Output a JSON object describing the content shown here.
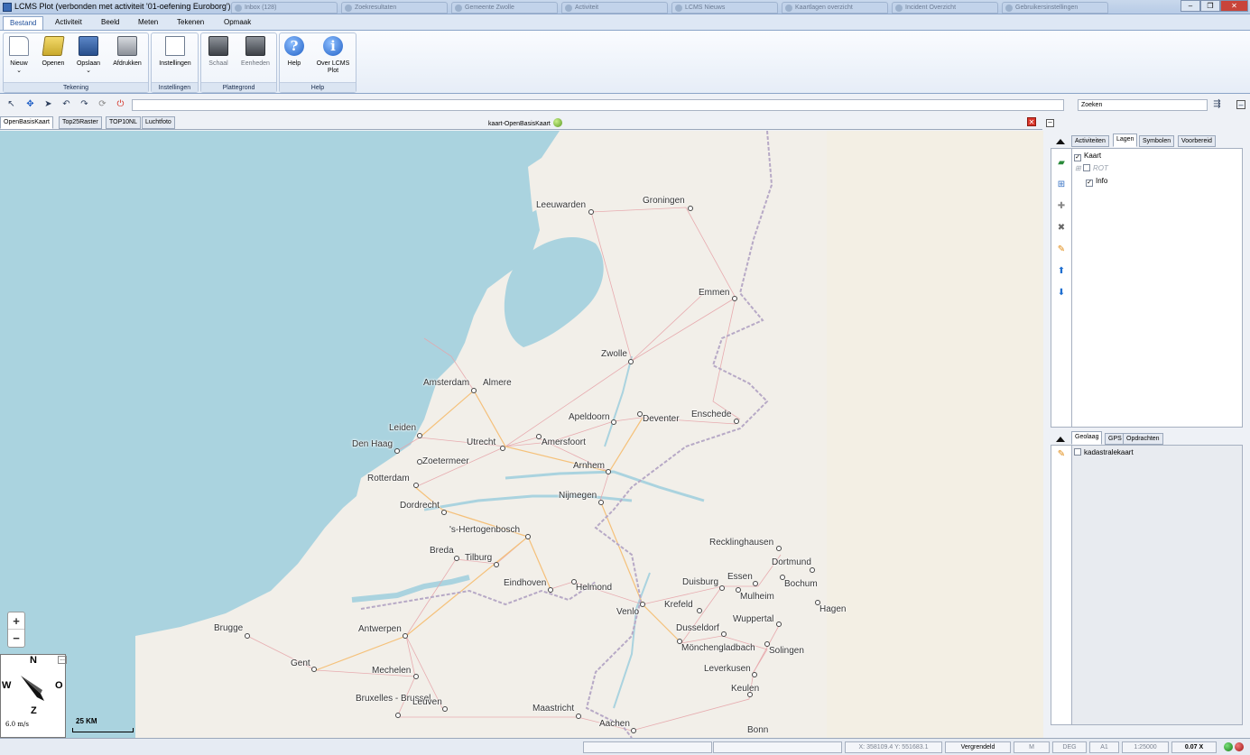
{
  "window": {
    "title": "LCMS Plot (verbonden met activiteit '01-oefening Euroborg')",
    "browser_tabs": [
      "Inbox (128)",
      "Zoekresultaten",
      "Gemeente Zwolle",
      "Activiteit",
      "LCMS Nieuws",
      "Kaartlagen overzicht",
      "Incident Overzicht",
      "Gebruikersinstellingen"
    ]
  },
  "menu": [
    "Bestand",
    "Activiteit",
    "Beeld",
    "Meten",
    "Tekenen",
    "Opmaak"
  ],
  "ribbon": {
    "groups": [
      {
        "name": "Tekening",
        "buttons": [
          "Nieuw",
          "Openen",
          "Opslaan",
          "Afdrukken"
        ]
      },
      {
        "name": "Instellingen",
        "buttons": [
          "Instellingen"
        ]
      },
      {
        "name": "Plattegrond",
        "buttons": [
          "Schaal",
          "Eenheden"
        ]
      },
      {
        "name": "Help",
        "buttons": [
          "Help",
          "Over LCMS Plot"
        ]
      }
    ]
  },
  "search": {
    "placeholder": "Zoeken"
  },
  "map_tabs": [
    "OpenBasisKaart",
    "Top25Raster",
    "TOP10NL",
    "Luchtfoto"
  ],
  "map_title": "kaart-OpenBasisKaart",
  "map": {
    "cities": [
      "Leeuwarden",
      "Groningen",
      "Emmen",
      "Zwolle",
      "Amsterdam",
      "Almere",
      "Apeldoorn",
      "Deventer",
      "Enschede",
      "Leiden",
      "Den Haag",
      "Utrecht",
      "Amersfoort",
      "Zoetermeer",
      "Arnhem",
      "Rotterdam",
      "Nijmegen",
      "Dordrecht",
      "'s-Hertogenbosch",
      "Breda",
      "Tilburg",
      "Recklinghausen",
      "Dortmund",
      "Eindhoven",
      "Helmond",
      "Essen",
      "Bochum",
      "Duisburg",
      "Mulheim",
      "Venlo",
      "Krefeld",
      "Hagen",
      "Brugge",
      "Antwerpen",
      "Wuppertal",
      "Dusseldorf",
      "Mönchengladbach",
      "Solingen",
      "Gent",
      "Mechelen",
      "Leverkusen",
      "Keulen",
      "Bruxelles - Brussel",
      "Leuven",
      "Maastricht",
      "Aachen",
      "Bonn"
    ],
    "zoom_in": "+",
    "zoom_out": "−",
    "compass": {
      "n": "N",
      "w": "W",
      "o": "O",
      "z": "Z",
      "wind": "6.0 m/s",
      "more": "..."
    },
    "scale_label": "25 KM"
  },
  "panel": {
    "top_tabs": [
      "Activiteiten",
      "Lagen",
      "Symbolen",
      "Voorbereid"
    ],
    "layers": {
      "root": "Kaart",
      "child1": "ROT",
      "child2": "Info"
    },
    "bottom_tabs": [
      "Geolaag",
      "GPS",
      "Opdrachten"
    ],
    "geolayers": [
      "kadastralekaart"
    ]
  },
  "status": {
    "coords": "X: 358109.4  Y: 551683.1",
    "lock": "Vergrendeld",
    "m": "M",
    "deg": "DEG",
    "paper": "A1",
    "scale": "1:25000",
    "zoom": "0.07 X"
  },
  "colors": {
    "sea": "#aad3df",
    "land": "#f2efe9",
    "accent": "#1f4f9b"
  }
}
